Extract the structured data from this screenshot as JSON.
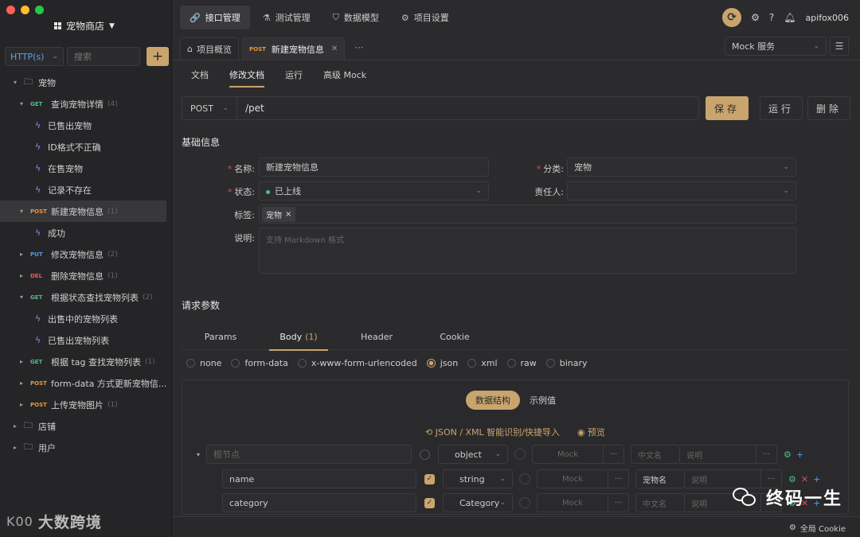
{
  "window": {
    "project_name": "宠物商店"
  },
  "sidebar": {
    "protocol": "HTTP(s)",
    "search_placeholder": "搜索",
    "add_label": "+",
    "tree": [
      {
        "kind": "folder",
        "label": "宠物",
        "level": 0,
        "open": true
      },
      {
        "kind": "api",
        "method": "GET",
        "label": "查询宠物详情",
        "count": "(4)",
        "level": 1,
        "open": true
      },
      {
        "kind": "case",
        "label": "已售出宠物",
        "level": 2
      },
      {
        "kind": "case",
        "label": "ID格式不正确",
        "level": 2
      },
      {
        "kind": "case",
        "label": "在售宠物",
        "level": 2
      },
      {
        "kind": "case",
        "label": "记录不存在",
        "level": 2
      },
      {
        "kind": "api",
        "method": "POST",
        "label": "新建宠物信息",
        "count": "(1)",
        "level": 1,
        "open": true,
        "selected": true
      },
      {
        "kind": "case",
        "label": "成功",
        "level": 2
      },
      {
        "kind": "api",
        "method": "PUT",
        "label": "修改宠物信息",
        "count": "(2)",
        "level": 1
      },
      {
        "kind": "api",
        "method": "DEL",
        "label": "删除宠物信息",
        "count": "(1)",
        "level": 1
      },
      {
        "kind": "api",
        "method": "GET",
        "label": "根据状态查找宠物列表",
        "count": "(2)",
        "level": 1,
        "open": true
      },
      {
        "kind": "case",
        "label": "出售中的宠物列表",
        "level": 2
      },
      {
        "kind": "case",
        "label": "已售出宠物列表",
        "level": 2
      },
      {
        "kind": "api",
        "method": "GET",
        "label": "根据 tag 查找宠物列表",
        "count": "(1)",
        "level": 1
      },
      {
        "kind": "api",
        "method": "POST",
        "label": "form-data 方式更新宠物信...",
        "count": "",
        "level": 1
      },
      {
        "kind": "api",
        "method": "POST",
        "label": "上传宠物图片",
        "count": "(1)",
        "level": 1
      },
      {
        "kind": "folder",
        "label": "店铺",
        "level": 0
      },
      {
        "kind": "folder",
        "label": "用户",
        "level": 0
      }
    ],
    "watermark": "大数跨境",
    "watermark_logo": "K00"
  },
  "topnav": {
    "tabs": [
      {
        "label": "接口管理",
        "icon": "link-icon",
        "glyph": "🔗",
        "active": true
      },
      {
        "label": "测试管理",
        "icon": "flask-icon",
        "glyph": "⚗",
        "active": false
      },
      {
        "label": "数据模型",
        "icon": "model-icon",
        "glyph": "⛉",
        "active": false
      },
      {
        "label": "项目设置",
        "icon": "gear-icon",
        "glyph": "⚙",
        "active": false
      }
    ],
    "username": "apifox006"
  },
  "filetabs": {
    "overview": "项目概览",
    "active_method": "POST",
    "active_label": "新建宠物信息",
    "more": "···",
    "mock_service": "Mock 服务"
  },
  "subtabs": [
    "文档",
    "修改文档",
    "运行",
    "高级 Mock"
  ],
  "request": {
    "method": "POST",
    "path": "/pet",
    "save": "保存",
    "run": "运行",
    "delete": "删除"
  },
  "basic": {
    "title": "基础信息",
    "name_label": "名称:",
    "name_value": "新建宠物信息",
    "category_label": "分类:",
    "category_value": "宠物",
    "status_label": "状态:",
    "status_value": "已上线",
    "owner_label": "责任人:",
    "owner_value": "",
    "tags_label": "标签:",
    "tag": "宠物",
    "desc_label": "说明:",
    "desc_placeholder": "支持 Markdown 格式"
  },
  "params": {
    "title": "请求参数",
    "tabs": [
      {
        "label": "Params",
        "num": ""
      },
      {
        "label": "Body",
        "num": "(1)",
        "active": true
      },
      {
        "label": "Header",
        "num": ""
      },
      {
        "label": "Cookie",
        "num": ""
      }
    ],
    "body_types": [
      {
        "label": "none",
        "checked": false
      },
      {
        "label": "form-data",
        "checked": false
      },
      {
        "label": "x-www-form-urlencoded",
        "checked": false
      },
      {
        "label": "json",
        "checked": true
      },
      {
        "label": "xml",
        "checked": false
      },
      {
        "label": "raw",
        "checked": false
      },
      {
        "label": "binary",
        "checked": false
      }
    ],
    "seg": [
      "数据结构",
      "示例值"
    ],
    "import_label": "JSON / XML 智能识别/快捷导入",
    "preview_label": "预览",
    "rows": [
      {
        "name": "根节点",
        "placeholder": true,
        "type": "object",
        "required": false,
        "mock": "Mock",
        "cn": "中文名",
        "cn_filled": false,
        "desc": "说明",
        "root": true
      },
      {
        "name": "name",
        "placeholder": false,
        "type": "string",
        "required": true,
        "mock": "Mock",
        "cn": "宠物名",
        "cn_filled": true,
        "desc": "说明"
      },
      {
        "name": "category",
        "placeholder": false,
        "type": "Category",
        "required": true,
        "mock": "Mock",
        "cn": "中文名",
        "cn_filled": false,
        "desc": "说明"
      }
    ]
  },
  "statusbar": {
    "cookie": "全局 Cookie"
  },
  "watermark_right": "终码一生"
}
